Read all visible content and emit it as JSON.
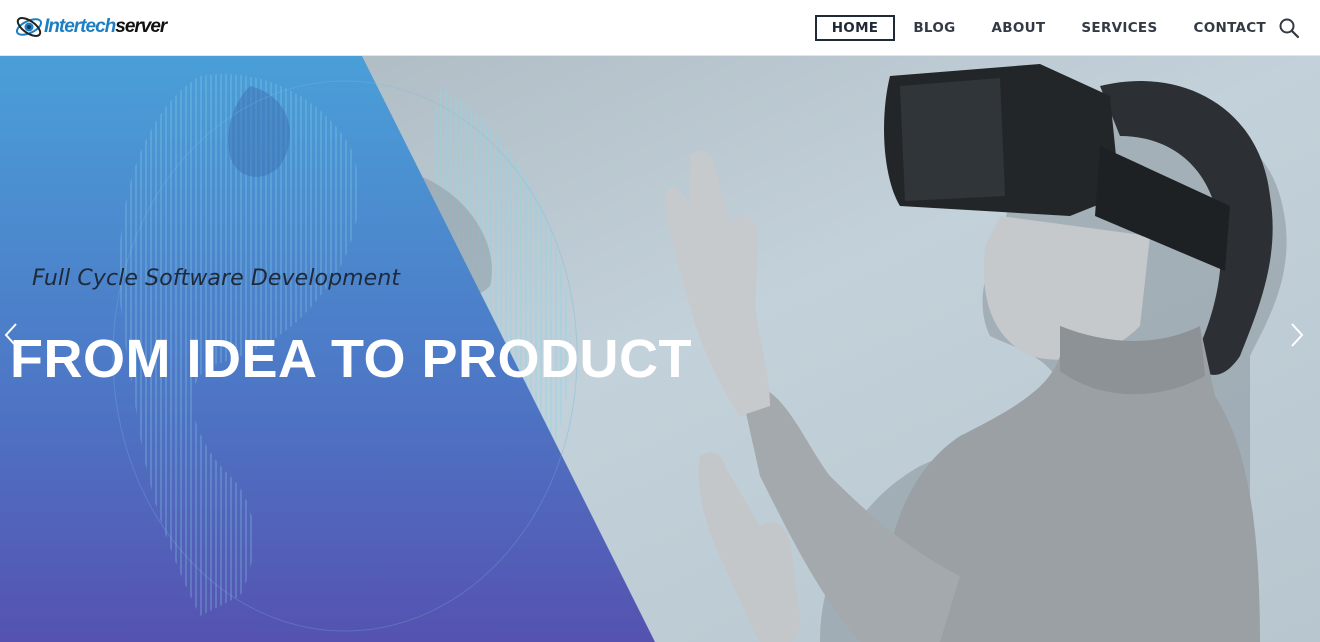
{
  "logo": {
    "text_part1": "Intertech",
    "text_part2": "server",
    "icon": "atom-logo-icon",
    "brand_color": "#1d7fc2"
  },
  "nav": {
    "items": [
      {
        "label": "HOME",
        "active": true
      },
      {
        "label": "BLOG",
        "active": false
      },
      {
        "label": "ABOUT",
        "active": false
      },
      {
        "label": "SERVICES",
        "active": false
      },
      {
        "label": "CONTACT",
        "active": false
      }
    ],
    "search_icon": "search-icon"
  },
  "hero": {
    "subtitle": "Full Cycle Software Development",
    "headline": "FROM IDEA TO PRODUCT",
    "prev_icon": "chevron-left-icon",
    "next_icon": "chevron-right-icon",
    "gradient_top": "#4a9fd8",
    "gradient_bottom": "#5552b0",
    "photo_tone": "#b9c9d4"
  }
}
